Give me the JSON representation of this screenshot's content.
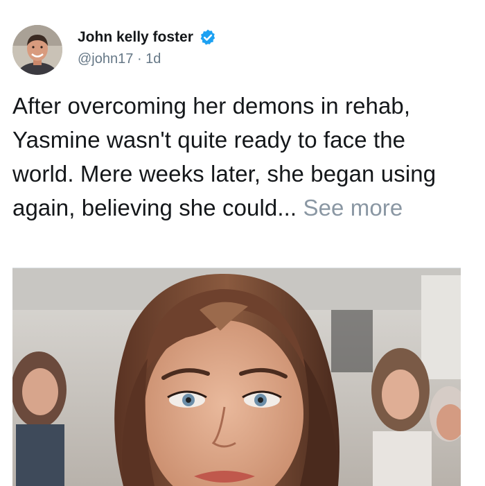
{
  "author": {
    "display_name": "John kelly foster",
    "handle": "@john17",
    "separator": "·",
    "time_ago": "1d",
    "verified": true
  },
  "post": {
    "text": "After overcoming her demons in rehab, Yasmine wasn't quite ready to face the world. Mere weeks later, she began using again, believing she could... ",
    "see_more_label": "See more"
  },
  "icons": {
    "verified": "verified-badge-icon",
    "avatar": "profile-photo"
  },
  "colors": {
    "text": "#14171a",
    "secondary_text": "#657786",
    "link_muted": "#8a97a3",
    "verified_blue": "#1da1f2"
  },
  "media": {
    "type": "photo",
    "subject": "woman-portrait"
  }
}
